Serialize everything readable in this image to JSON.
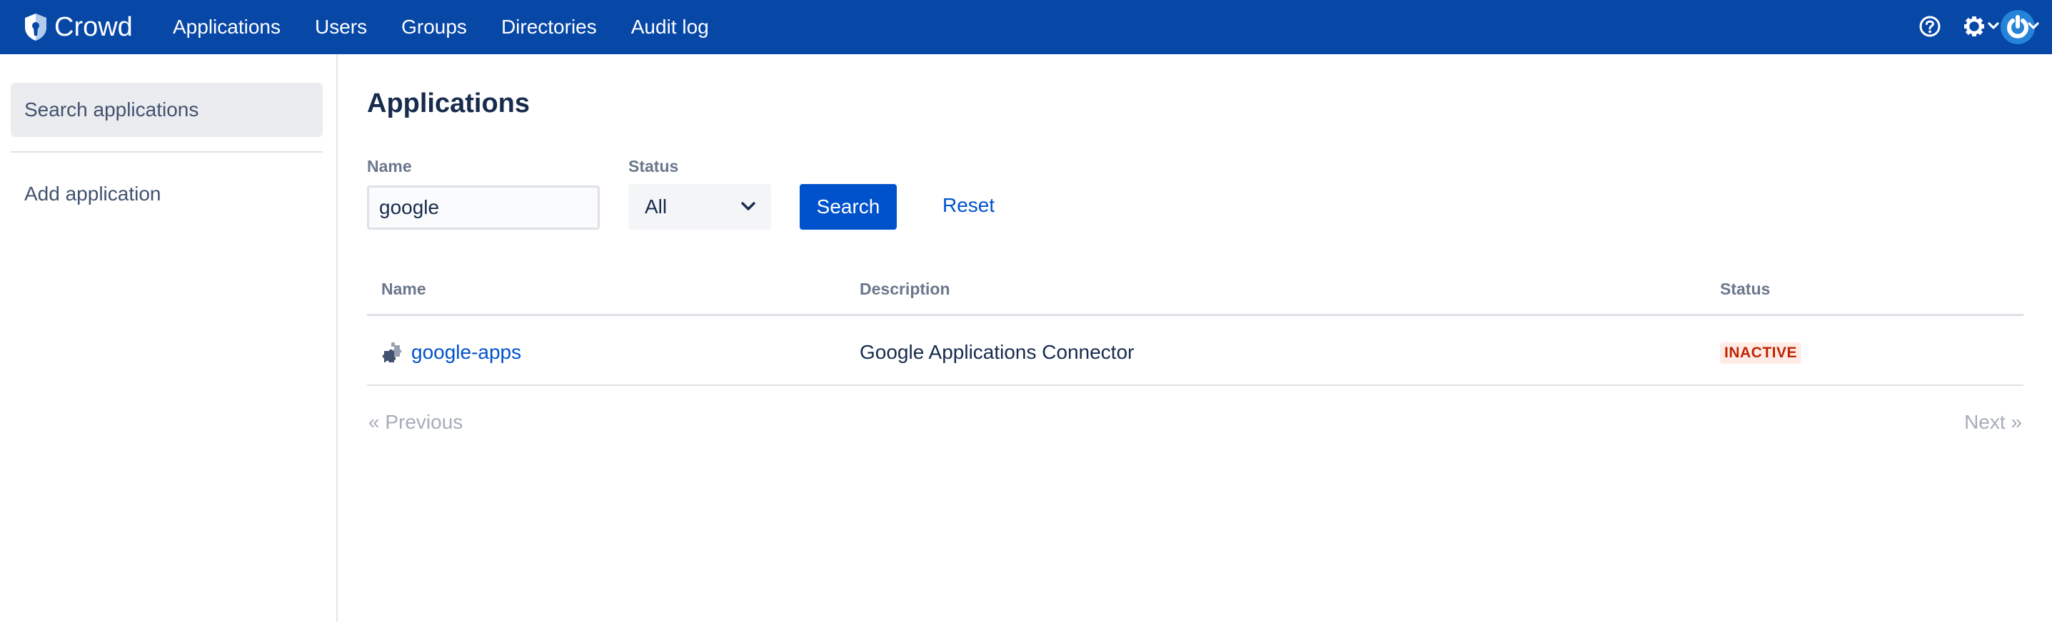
{
  "header": {
    "app_name": "Crowd",
    "nav": [
      "Applications",
      "Users",
      "Groups",
      "Directories",
      "Audit log"
    ],
    "icons": {
      "logo": "crowd-shield-logo",
      "help": "help-circle-icon",
      "settings": "gear-icon",
      "user": "power-avatar-icon"
    }
  },
  "sidebar": {
    "items": [
      {
        "label": "Search applications",
        "active": true
      },
      {
        "label": "Add application",
        "active": false
      }
    ]
  },
  "main": {
    "title": "Applications",
    "filters": {
      "name_label": "Name",
      "name_value": "google",
      "status_label": "Status",
      "status_value": "All",
      "search_label": "Search",
      "reset_label": "Reset"
    },
    "table": {
      "columns": [
        "Name",
        "Description",
        "Status"
      ],
      "rows": [
        {
          "name": "google-apps",
          "icon": "puzzle-piece-icon",
          "description": "Google Applications Connector",
          "status": "INACTIVE"
        }
      ]
    },
    "pagination": {
      "previous": "« Previous",
      "next": "Next »"
    }
  },
  "colors": {
    "header_bg": "#0747A6",
    "primary": "#0052CC",
    "inactive_text": "#BF2600",
    "inactive_bg": "#FFEBE6"
  }
}
